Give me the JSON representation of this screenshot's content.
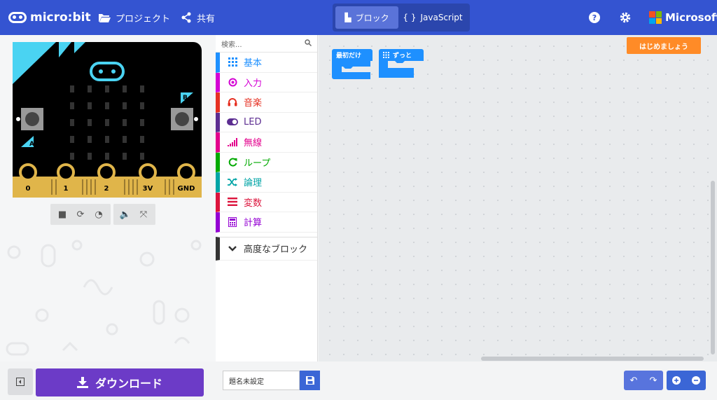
{
  "header": {
    "brand": "micro:bit",
    "projects_label": "プロジェクト",
    "share_label": "共有",
    "blocks_label": "ブロック",
    "js_label": "JavaScript",
    "ms_label": "Microsoft",
    "bg_color": "#3454d1"
  },
  "simulator": {
    "pins": [
      "0",
      "1",
      "2",
      "3V",
      "GND"
    ],
    "button_a": "A",
    "button_b": "B",
    "controls": [
      "stop-icon",
      "restart-icon",
      "slowmo-icon",
      "sound-icon",
      "fullscreen-icon"
    ]
  },
  "toolbox": {
    "search_placeholder": "検索...",
    "categories": [
      {
        "label": "基本",
        "color": "#1e90ff",
        "icon": "grid-icon"
      },
      {
        "label": "入力",
        "color": "#d400d4",
        "icon": "target-icon"
      },
      {
        "label": "音楽",
        "color": "#e63022",
        "icon": "headphones-icon"
      },
      {
        "label": "LED",
        "color": "#5c2d91",
        "icon": "toggle-icon"
      },
      {
        "label": "無線",
        "color": "#e3008c",
        "icon": "signal-icon"
      },
      {
        "label": "ループ",
        "color": "#00aa00",
        "icon": "loop-icon"
      },
      {
        "label": "論理",
        "color": "#00a4a6",
        "icon": "shuffle-icon"
      },
      {
        "label": "変数",
        "color": "#dc143c",
        "icon": "list-icon"
      },
      {
        "label": "計算",
        "color": "#9400d3",
        "icon": "calculator-icon"
      }
    ],
    "advanced_label": "高度なブロック"
  },
  "workspace": {
    "start_tutorial": "はじめましょう",
    "blocks": [
      {
        "label": "最初だけ",
        "color": "#1e90ff"
      },
      {
        "label": "ずっと",
        "color": "#1e90ff"
      }
    ]
  },
  "footer": {
    "download_label": "ダウンロード",
    "project_name": "題名未設定",
    "download_color": "#6c3bc7"
  }
}
